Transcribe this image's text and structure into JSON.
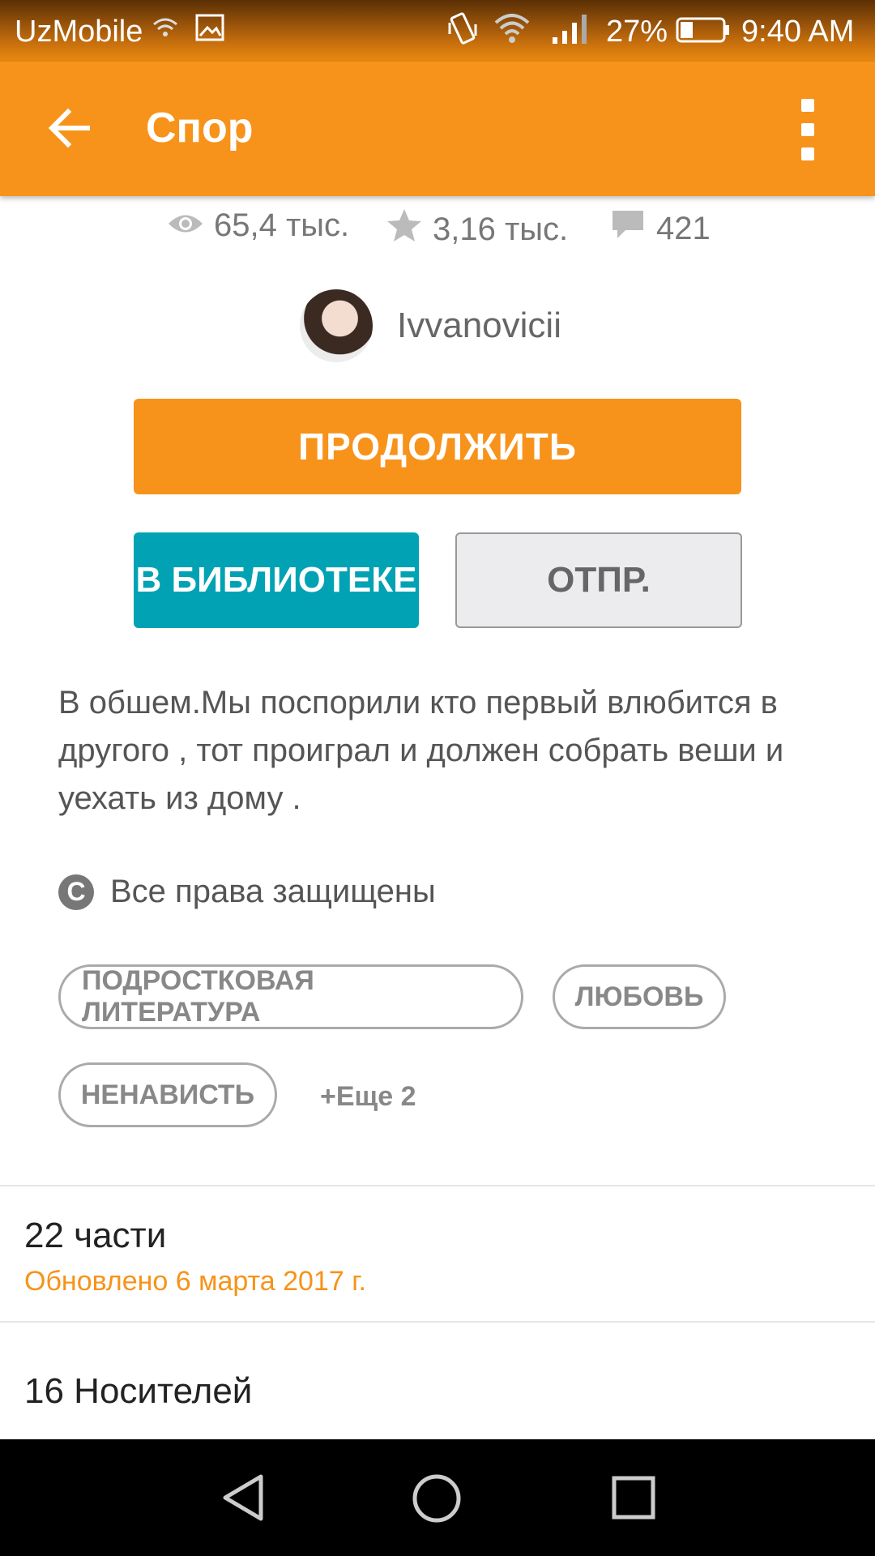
{
  "status_bar": {
    "carrier": "UzMobile",
    "battery_percent": "27%",
    "time": "9:40 AM"
  },
  "app_bar": {
    "title": "Спор"
  },
  "stats": {
    "reads": "65,4 тыс.",
    "votes": "3,16 тыс.",
    "comments": "421"
  },
  "author": {
    "name": "Ivvanovicii"
  },
  "buttons": {
    "continue": "ПРОДОЛЖИТЬ",
    "library": "В БИБЛИОТЕКЕ",
    "send": "ОТПР."
  },
  "description": "В обшем.Мы поспорили кто первый влюбится в другого , тот проиграл и должен собрать веши и уехать из дому .",
  "copyright": "Все права защищены",
  "tags": [
    "ПОДРОСТКОВАЯ ЛИТЕРАТУРА",
    "ЛЮБОВЬ",
    "НЕНАВИСТЬ"
  ],
  "tags_more": "+Еще 2",
  "parts": {
    "count": "22 части",
    "updated": "Обновлено 6 марта 2017 г."
  },
  "carriers": "16 Носителей",
  "colors": {
    "accent": "#f7931a",
    "library": "#00a2b3"
  }
}
